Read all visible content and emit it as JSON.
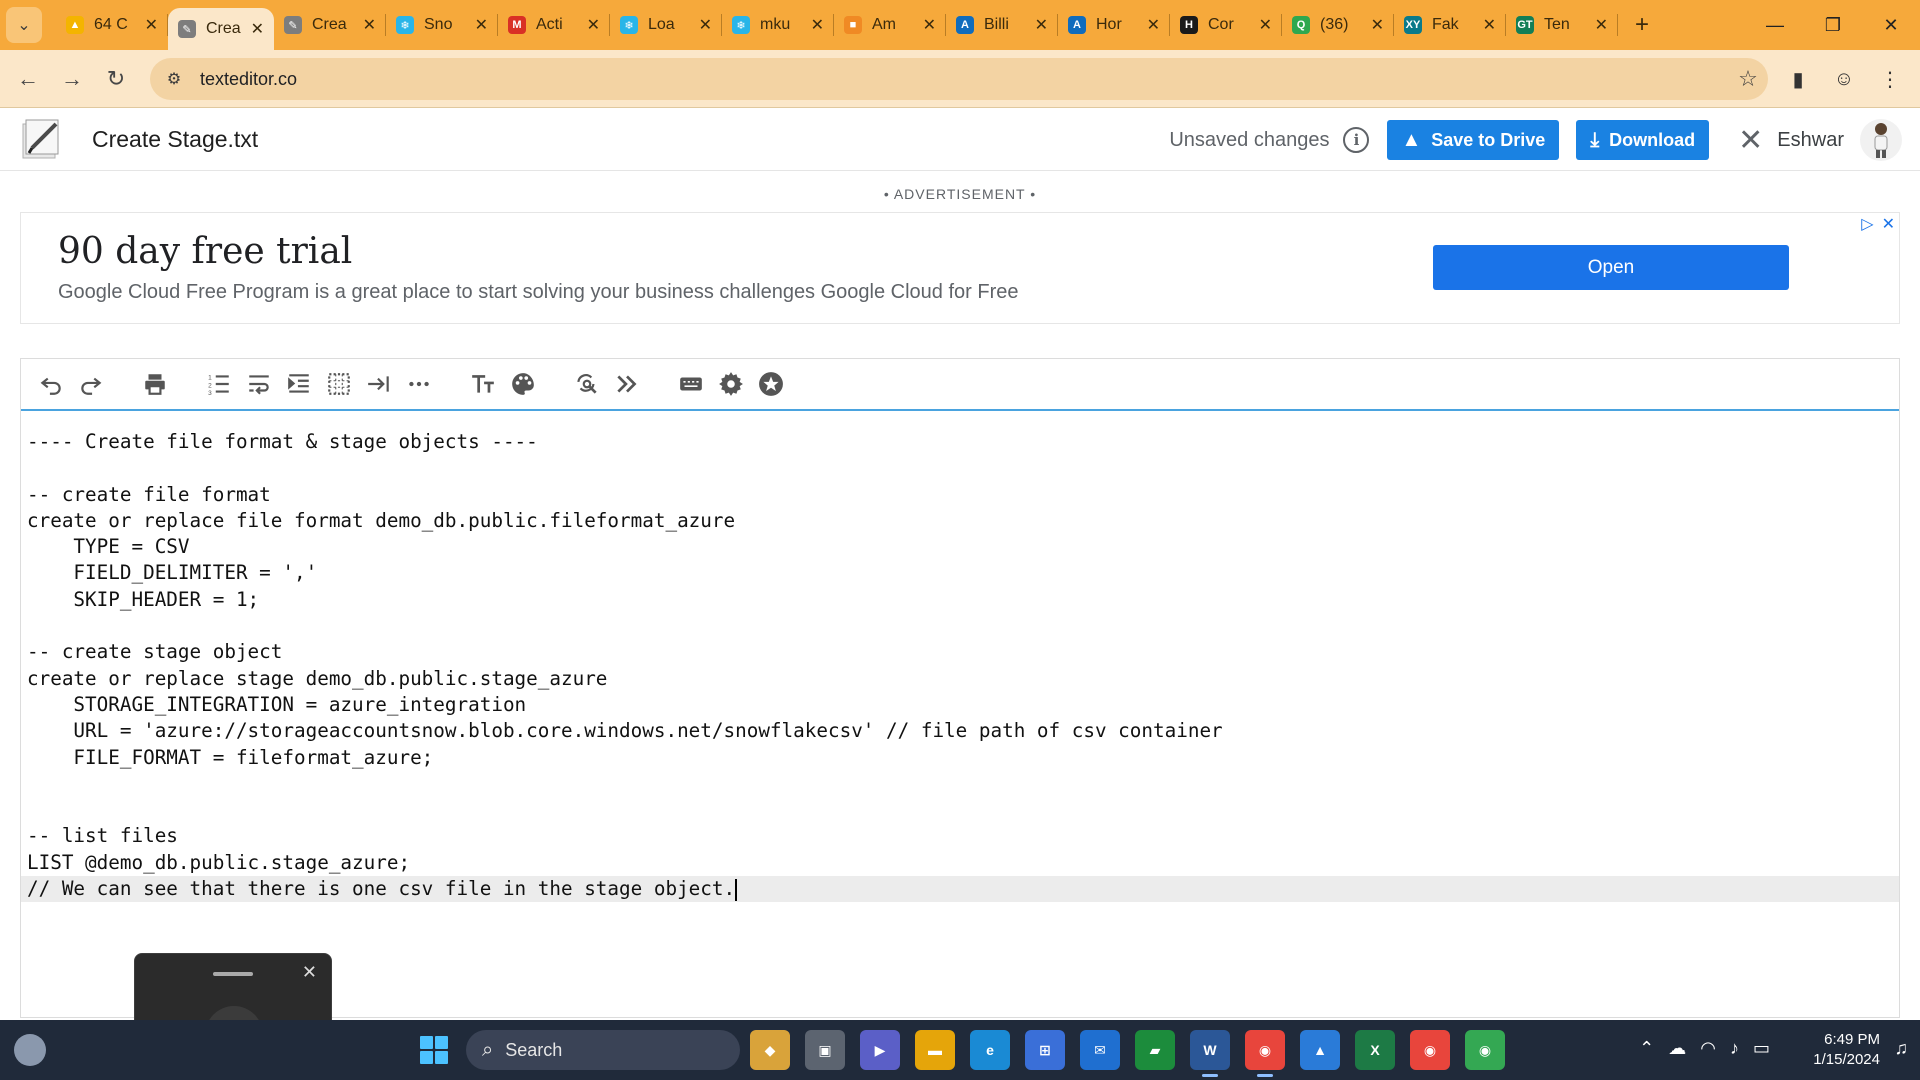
{
  "browser": {
    "tabs": [
      {
        "title": "64 C",
        "color": "#f4b400",
        "glyph": "▲"
      },
      {
        "title": "Crea",
        "color": "#7d7d7d",
        "glyph": "✎",
        "active": true
      },
      {
        "title": "Crea",
        "color": "#7d7d7d",
        "glyph": "✎"
      },
      {
        "title": "Sno",
        "color": "#29b5e8",
        "glyph": "❄"
      },
      {
        "title": "Acti",
        "color": "#d93025",
        "glyph": "M"
      },
      {
        "title": "Loa",
        "color": "#29b5e8",
        "glyph": "❄"
      },
      {
        "title": "mku",
        "color": "#29b5e8",
        "glyph": "❄"
      },
      {
        "title": "Am",
        "color": "#f08a24",
        "glyph": "■"
      },
      {
        "title": "Billi",
        "color": "#0f6cbd",
        "glyph": "A"
      },
      {
        "title": "Hor",
        "color": "#0f6cbd",
        "glyph": "A"
      },
      {
        "title": "Cor",
        "color": "#1a1a1a",
        "glyph": "H"
      },
      {
        "title": "(36)",
        "color": "#2fa84f",
        "glyph": "Q"
      },
      {
        "title": "Fak",
        "color": "#0a7a8a",
        "glyph": "XY"
      },
      {
        "title": "Ten",
        "color": "#137e56",
        "glyph": "GT"
      }
    ],
    "url": "texteditor.co"
  },
  "app": {
    "filename": "Create Stage.txt",
    "status": "Unsaved changes",
    "save_label": "Save to Drive",
    "download_label": "Download",
    "user": "Eshwar"
  },
  "ad": {
    "label": "• ADVERTISEMENT •",
    "title": "90 day free trial",
    "description": "Google Cloud Free Program is a great place to start solving your business challenges Google Cloud for Free",
    "button": "Open"
  },
  "editor": {
    "lines": [
      "---- Create file format & stage objects ----",
      "",
      "-- create file format",
      "create or replace file format demo_db.public.fileformat_azure",
      "    TYPE = CSV",
      "    FIELD_DELIMITER = ','",
      "    SKIP_HEADER = 1;",
      "",
      "-- create stage object",
      "create or replace stage demo_db.public.stage_azure",
      "    STORAGE_INTEGRATION = azure_integration",
      "    URL = 'azure://storageaccountsnow.blob.core.windows.net/snowflakecsv' // file path of csv container",
      "    FILE_FORMAT = fileformat_azure;",
      "",
      "",
      "-- list files",
      "LIST @demo_db.public.stage_azure;",
      "// We can see that there is one csv file in the stage object."
    ]
  },
  "taskbar": {
    "search": "Search",
    "time": "6:49 PM",
    "date": "1/15/2024"
  }
}
